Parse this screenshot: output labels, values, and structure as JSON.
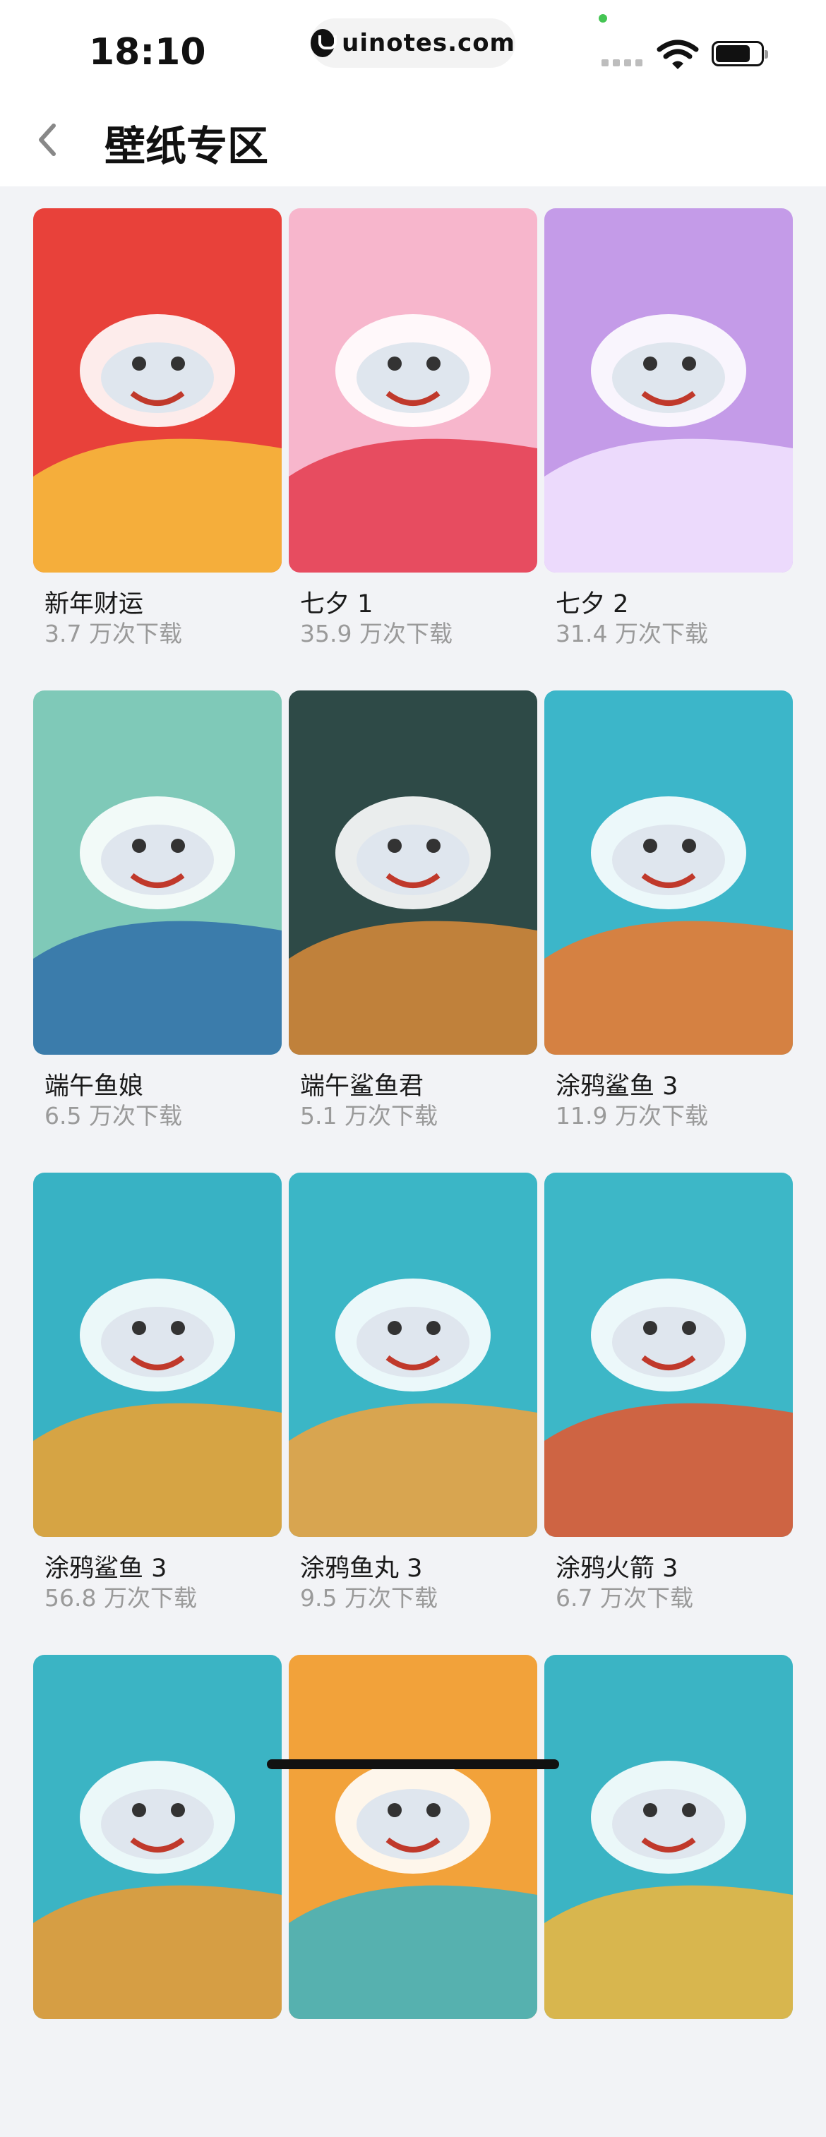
{
  "status": {
    "time": "18:10",
    "url": "uinotes.com"
  },
  "header": {
    "title": "壁纸专区"
  },
  "wallpapers": [
    {
      "title": "新年财运",
      "downloads": "3.7 万次下载",
      "bg": "#e8413a",
      "accent": "#f7c23c"
    },
    {
      "title": "七夕 1",
      "downloads": "35.9 万次下载",
      "bg": "#f7b6cc",
      "accent": "#e43a4c"
    },
    {
      "title": "七夕 2",
      "downloads": "31.4 万次下载",
      "bg": "#c49be8",
      "accent": "#f3e5ff"
    },
    {
      "title": "端午鱼娘",
      "downloads": "6.5 万次下载",
      "bg": "#7fc9b8",
      "accent": "#2f6ea8"
    },
    {
      "title": "端午鲨鱼君",
      "downloads": "5.1 万次下载",
      "bg": "#2e4a47",
      "accent": "#d98b3a"
    },
    {
      "title": "涂鸦鲨鱼 3",
      "downloads": "11.9 万次下载",
      "bg": "#3cb6c9",
      "accent": "#f0782a"
    },
    {
      "title": "涂鸦鲨鱼 3",
      "downloads": "56.8 万次下载",
      "bg": "#38b2c4",
      "accent": "#f2a12e"
    },
    {
      "title": "涂鸦鱼丸 3",
      "downloads": "9.5 万次下载",
      "bg": "#3bb6c6",
      "accent": "#f5a23b"
    },
    {
      "title": "涂鸦火箭 3",
      "downloads": "6.7 万次下载",
      "bg": "#3db7c7",
      "accent": "#e8562c"
    },
    {
      "title": "",
      "downloads": "",
      "bg": "#3bb4c4",
      "accent": "#f29a2e"
    },
    {
      "title": "",
      "downloads": "",
      "bg": "#f2a23a",
      "accent": "#3bb4c4"
    },
    {
      "title": "",
      "downloads": "",
      "bg": "#3bb4c4",
      "accent": "#f4b63a"
    }
  ]
}
